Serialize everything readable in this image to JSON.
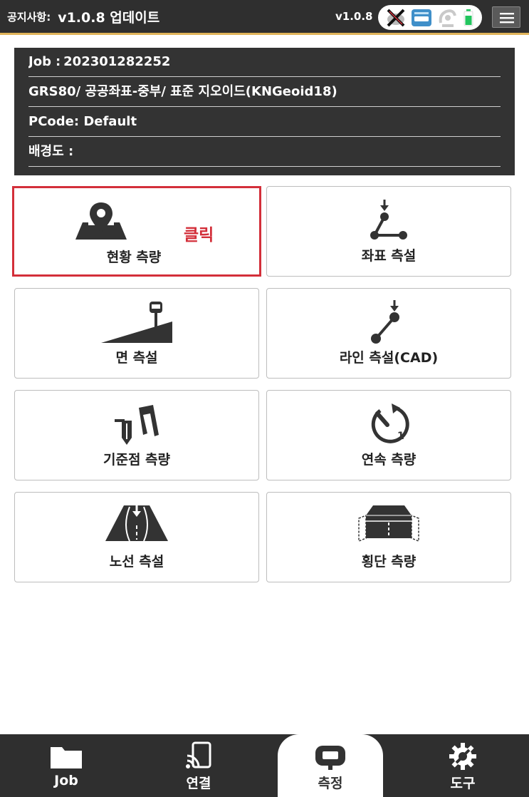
{
  "topbar": {
    "notice_label": "공지사항:",
    "notice_text": "v1.0.8 업데이트",
    "version": "v1.0.8",
    "status_icons": [
      "gnss-disconnected-icon",
      "radio-icon",
      "satellite-icon",
      "battery-icon"
    ],
    "menu_icon": "hamburger-menu-icon"
  },
  "job_info": {
    "job_label": "Job",
    "job_value": "202301282252",
    "coord_system": "GRS80/ 공공좌표-중부/ 표준 지오이드(KNGeoid18)",
    "pcode": "PCode: Default",
    "background_label": "배경도 :"
  },
  "menu": {
    "click_note": "클릭",
    "items": [
      {
        "label": "현황 측량",
        "icon": "map-pin-icon"
      },
      {
        "label": "좌표 측설",
        "icon": "stakeout-point-icon"
      },
      {
        "label": "면 측설",
        "icon": "surface-stakeout-icon"
      },
      {
        "label": "라인 측설(CAD)",
        "icon": "line-stakeout-icon"
      },
      {
        "label": "기준점 측량",
        "icon": "control-point-icon"
      },
      {
        "label": "연속 측량",
        "icon": "continuous-timer-icon"
      },
      {
        "label": "노선 측설",
        "icon": "road-stakeout-icon"
      },
      {
        "label": "횡단 측량",
        "icon": "cross-section-icon"
      }
    ]
  },
  "bottom_nav": {
    "items": [
      {
        "label": "Job",
        "icon": "folder-icon"
      },
      {
        "label": "연결",
        "icon": "device-connect-icon"
      },
      {
        "label": "측정",
        "icon": "gnss-receiver-icon"
      },
      {
        "label": "도구",
        "icon": "gear-wrench-icon"
      }
    ],
    "active": "측정"
  },
  "colors": {
    "bar_bg": "#2f2f2f",
    "accent_line": "#e0b45a",
    "highlight_red": "#d32f3a",
    "battery_green": "#22c55e",
    "radio_blue": "#3f8fc9"
  }
}
